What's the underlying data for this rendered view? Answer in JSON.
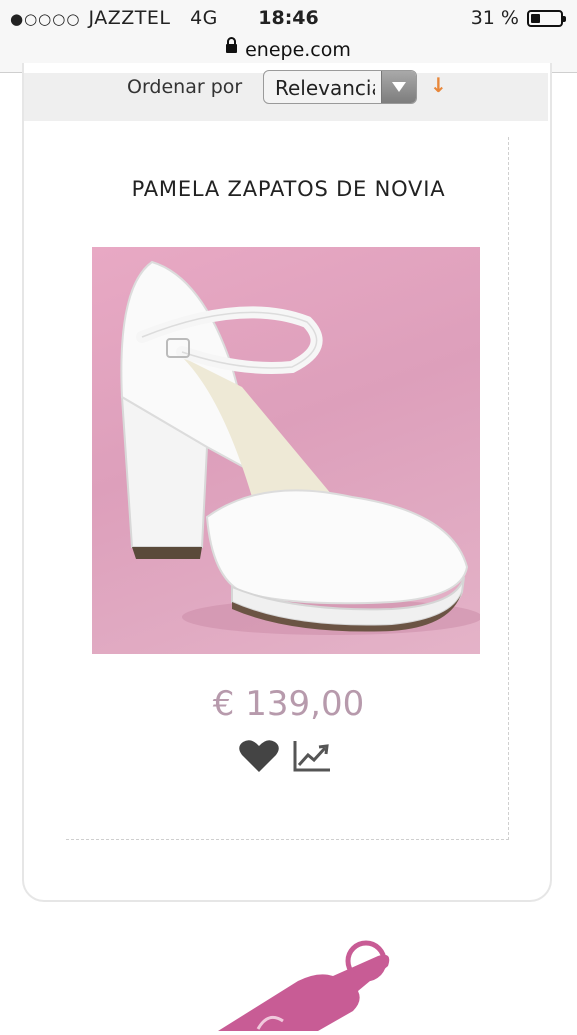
{
  "status_bar": {
    "signal_dots": "●○○○○",
    "carrier": "JAZZTEL",
    "network": "4G",
    "time": "18:46",
    "battery_percent": "31 %",
    "battery_level": 0.31
  },
  "browser": {
    "url": "enepe.com"
  },
  "sort": {
    "label": "Ordenar por",
    "selected": "Relevancia",
    "direction_glyph": "↓"
  },
  "product": {
    "title": "PAMELA ZAPATOS DE NOVIA",
    "price": "€ 139,00",
    "favorite_icon": "heart-icon",
    "stats_icon": "trend-chart-icon"
  },
  "colors": {
    "price": "#b79aac",
    "sort_arrow": "#e8873a",
    "image_background": "#e0a3bf",
    "tag": "#c85c95"
  }
}
